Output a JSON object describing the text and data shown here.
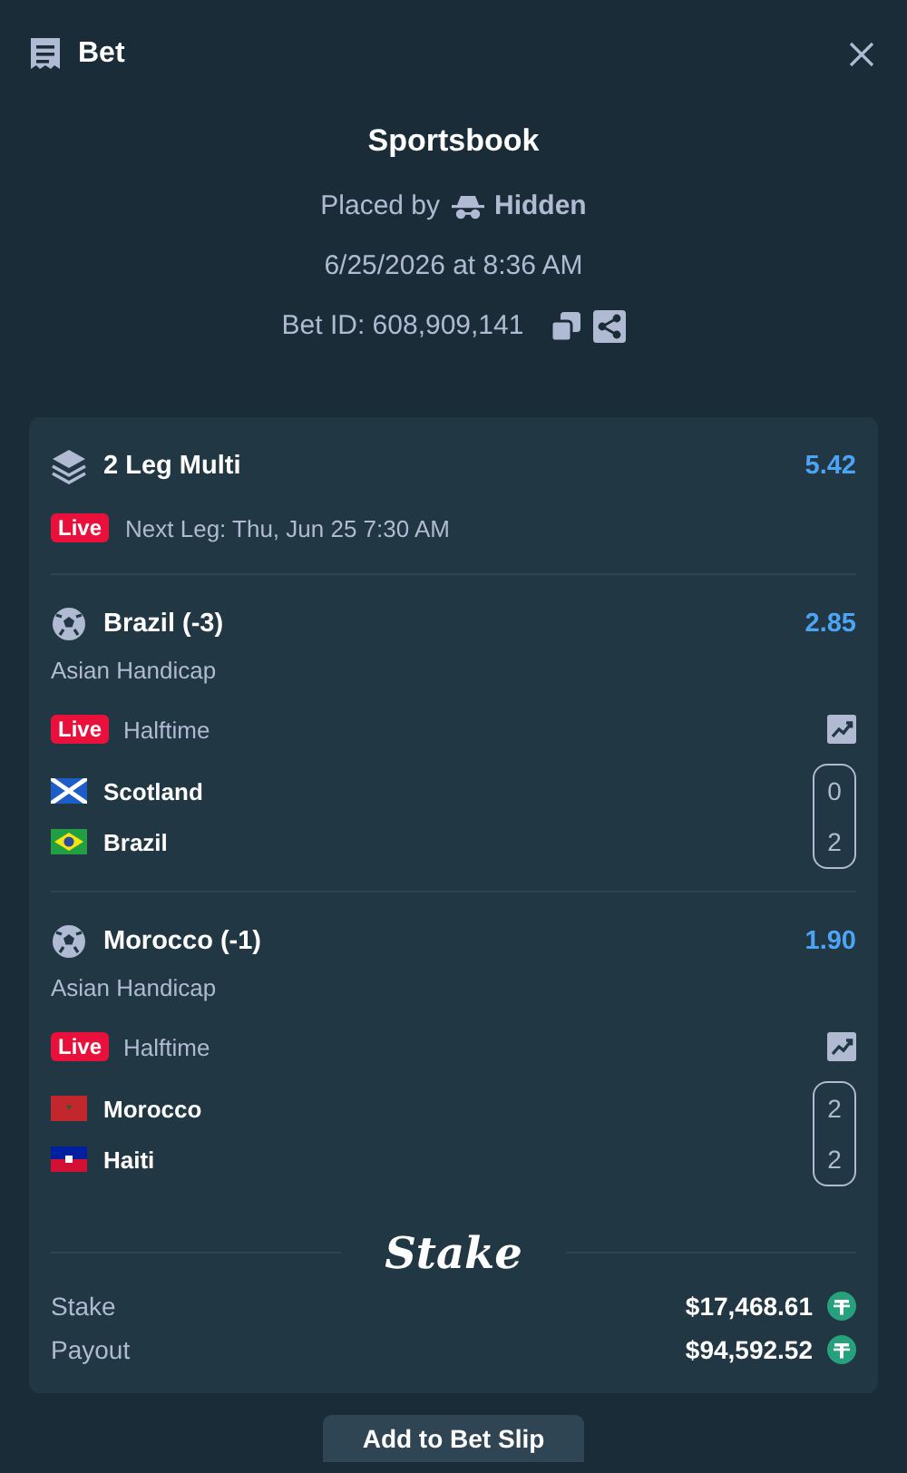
{
  "header": {
    "title": "Bet"
  },
  "summary": {
    "title": "Sportsbook",
    "placed_by_label": "Placed by",
    "placed_by_user": "Hidden",
    "date": "6/25/2026 at 8:36 AM",
    "bet_id": "Bet ID: 608,909,141"
  },
  "bet": {
    "title": "2 Leg Multi",
    "odds": "5.42",
    "status_badge": "Live",
    "next_leg": "Next Leg: Thu, Jun 25 7:30 AM"
  },
  "legs": [
    {
      "selection": "Brazil (-3)",
      "odds": "2.85",
      "market": "Asian Handicap",
      "status_badge": "Live",
      "period": "Halftime",
      "teams": [
        {
          "kind": "scotland",
          "name": "Scotland",
          "score": "0"
        },
        {
          "kind": "brazil",
          "name": "Brazil",
          "score": "2"
        }
      ]
    },
    {
      "selection": "Morocco (-1)",
      "odds": "1.90",
      "market": "Asian Handicap",
      "status_badge": "Live",
      "period": "Halftime",
      "teams": [
        {
          "kind": "morocco",
          "name": "Morocco",
          "score": "2"
        },
        {
          "kind": "haiti",
          "name": "Haiti",
          "score": "2"
        }
      ]
    }
  ],
  "brand": "Stake",
  "totals": [
    {
      "label": "Stake",
      "amount": "$17,468.61"
    },
    {
      "label": "Payout",
      "amount": "$94,592.52"
    }
  ],
  "footer_button": "Add to Bet Slip"
}
